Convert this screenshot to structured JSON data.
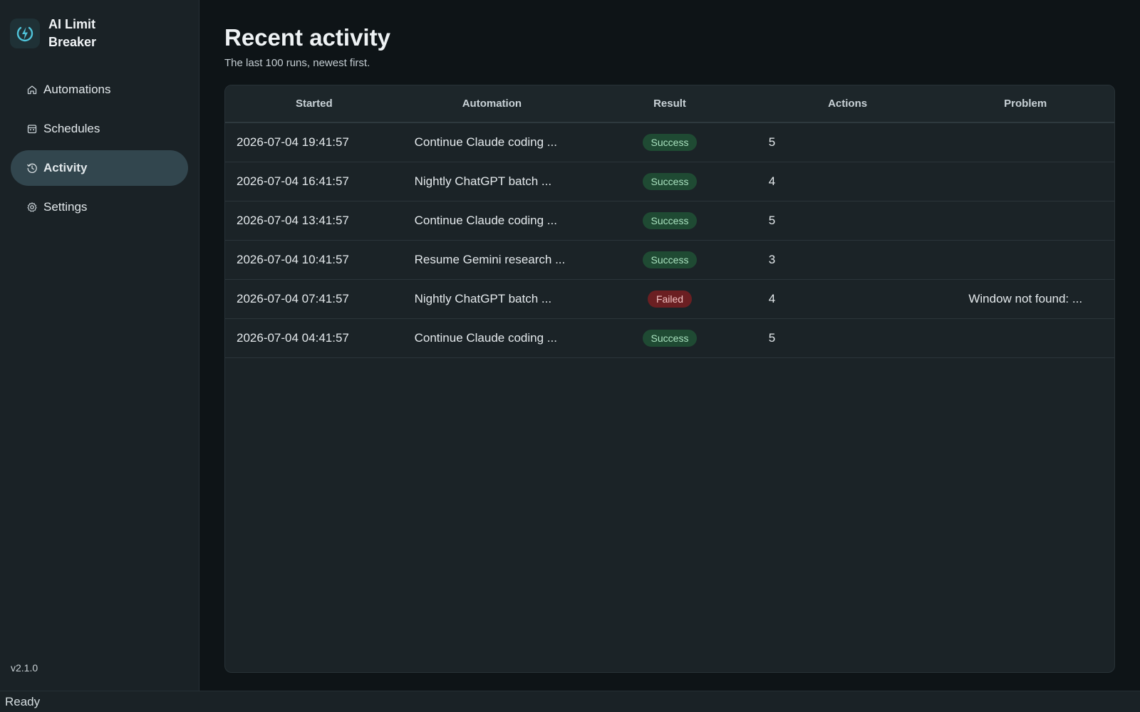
{
  "app": {
    "name": "AI Limit Breaker",
    "version": "v2.1.0",
    "accent": "#4fc3d9"
  },
  "sidebar": {
    "items": [
      {
        "label": "Automations",
        "icon": "home-icon",
        "active": false
      },
      {
        "label": "Schedules",
        "icon": "calendar-icon",
        "active": false
      },
      {
        "label": "Activity",
        "icon": "history-icon",
        "active": true
      },
      {
        "label": "Settings",
        "icon": "gear-icon",
        "active": false
      }
    ]
  },
  "page": {
    "title": "Recent activity",
    "subtitle": "The last 100 runs, newest first."
  },
  "table": {
    "columns": [
      "Started",
      "Automation",
      "Result",
      "Actions",
      "Problem"
    ],
    "rows": [
      {
        "started": "2026-07-04 19:41:57",
        "automation": "Continue Claude coding ...",
        "result": "Success",
        "actions": "5",
        "problem": ""
      },
      {
        "started": "2026-07-04 16:41:57",
        "automation": "Nightly ChatGPT batch ...",
        "result": "Success",
        "actions": "4",
        "problem": ""
      },
      {
        "started": "2026-07-04 13:41:57",
        "automation": "Continue Claude coding ...",
        "result": "Success",
        "actions": "5",
        "problem": ""
      },
      {
        "started": "2026-07-04 10:41:57",
        "automation": "Resume Gemini research ...",
        "result": "Success",
        "actions": "3",
        "problem": ""
      },
      {
        "started": "2026-07-04 07:41:57",
        "automation": "Nightly ChatGPT batch ...",
        "result": "Failed",
        "actions": "4",
        "problem": "Window not found: ..."
      },
      {
        "started": "2026-07-04 04:41:57",
        "automation": "Continue Claude coding ...",
        "result": "Success",
        "actions": "5",
        "problem": ""
      }
    ]
  },
  "statusbar": {
    "text": "Ready"
  },
  "colors": {
    "success_bg": "#1f4a33",
    "success_fg": "#a9e2bf",
    "failed_bg": "#6b1f22",
    "failed_fg": "#f3c3c3"
  }
}
